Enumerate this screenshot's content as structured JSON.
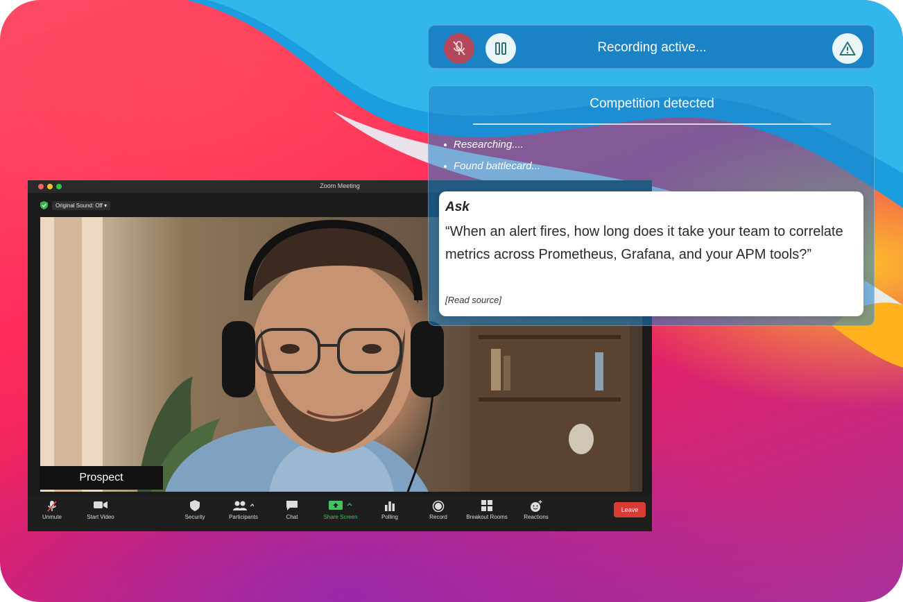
{
  "recorder": {
    "status": "Recording active...",
    "mic_icon": "mic-off-icon",
    "pause_icon": "pause-icon",
    "alert_icon": "warning-icon"
  },
  "panel": {
    "title": "Competition detected",
    "steps": [
      "Researching....",
      "Found battlecard..."
    ],
    "card": {
      "title": "Ask",
      "quote": "“When an alert fires, how long does it take your team to correlate metrics across Prometheus, Grafana, and your APM tools?”",
      "source": "[Read source]"
    }
  },
  "zoom": {
    "window_title": "Zoom Meeting",
    "original_sound": "Original Sound: Off",
    "participant_name": "Prospect",
    "toolbar": [
      {
        "label": "Unmute",
        "icon": "mic-muted-icon"
      },
      {
        "label": "Start Video",
        "icon": "video-camera-icon"
      },
      {
        "label": "Security",
        "icon": "shield-icon"
      },
      {
        "label": "Participants",
        "icon": "people-icon"
      },
      {
        "label": "Chat",
        "icon": "chat-bubble-icon"
      },
      {
        "label": "Share Screen",
        "icon": "share-screen-icon"
      },
      {
        "label": "Polling",
        "icon": "bar-chart-icon"
      },
      {
        "label": "Record",
        "icon": "record-icon"
      },
      {
        "label": "Breakout Rooms",
        "icon": "grid-icon"
      },
      {
        "label": "Reactions",
        "icon": "emoji-icon"
      }
    ],
    "leave_label": "Leave"
  },
  "colors": {
    "leave": "#d93c34",
    "share_screen_label": "#43c35c",
    "mic_button": "#b3485a",
    "security_badge": "#3db14e"
  }
}
